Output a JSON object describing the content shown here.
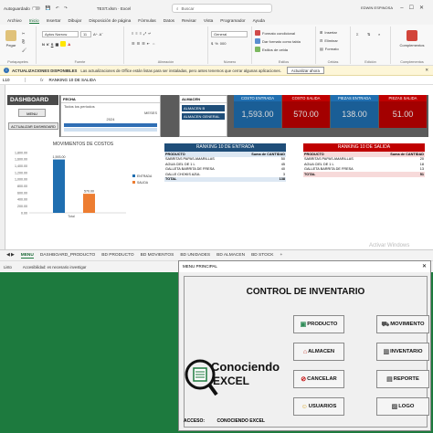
{
  "titlebar": {
    "autosave": "Autoguardado",
    "filename": "TEST.xlsm  ·  Excel",
    "search_placeholder": "Buscar",
    "user": "EDWIN ESPINOSA"
  },
  "menu": [
    "Archivo",
    "Inicio",
    "Insertar",
    "Dibujar",
    "Disposición de página",
    "Fórmulas",
    "Datos",
    "Revisar",
    "Vista",
    "Programador",
    "Ayuda"
  ],
  "menu_active": "Inicio",
  "ribbon": {
    "pegar": "Pegar",
    "portapapeles": "Portapapeles",
    "font_name": "Aptos Narrow",
    "font_size": "11",
    "fuente": "Fuente",
    "alineacion": "Alineación",
    "number_format": "General",
    "numero": "Número",
    "formato_condicional": "Formato condicional",
    "dar_formato_tabla": "Dar formato como tabla",
    "estilos_celda": "Estilos de celda",
    "estilos": "Estilos",
    "insertar": "Insertar",
    "eliminar": "Eliminar",
    "formato": "Formato",
    "celdas": "Celdas",
    "edicion": "Edición",
    "complementos": "Complementos"
  },
  "notice": {
    "title": "ACTUALIZACIONES DISPONIBLES",
    "text": "Las actualizaciones de Office están listas para ser instaladas, pero antes tenemos que cerrar algunas aplicaciones.",
    "button": "Actualizar ahora"
  },
  "formula_bar": {
    "ref": "L10",
    "fx": "fx",
    "value": "RANKING 10 DE SALIDA"
  },
  "dashboard": {
    "title": "DASHBOARD",
    "menu_button": "MENU",
    "update_button": "ACTUALIZAR DASHBOARD",
    "date_slicer": {
      "header": "FECHA",
      "period": "Todos los períodos",
      "unit": "MESES",
      "year": "2024"
    },
    "alm_slicer": {
      "header": "ALMACEN",
      "items": [
        "ALMACEN B",
        "ALMACEN GENERAL"
      ]
    },
    "kpis": [
      {
        "label": "COSTO ENTRADA",
        "value": "1,593.00",
        "color": "#1f6eb0"
      },
      {
        "label": "COSTO SALIDA",
        "value": "570.00",
        "color": "#c00000"
      },
      {
        "label": "PIEZAS ENTRADA",
        "value": "138.00",
        "color": "#1f6eb0"
      },
      {
        "label": "PIEZAS SALIDA",
        "value": "51.00",
        "color": "#c00000"
      }
    ]
  },
  "rank_in": {
    "title": "RANKING 10 DE ENTRADA",
    "header_color": "#1f4e79",
    "col1": "PRODUCTO",
    "col2": "Suma de CANTIDAD",
    "rows": [
      {
        "p": "SABRITAS PAPAS AMARILLAS",
        "q": "50"
      },
      {
        "p": "AGUA CIEL DE 1 L",
        "q": "45"
      },
      {
        "p": "GALLETA BARRITA DE FRESA",
        "q": "40"
      },
      {
        "p": "GALLE CHOKIS AZUL",
        "q": "3"
      }
    ],
    "total_label": "TOTAL",
    "total": "138"
  },
  "rank_out": {
    "title": "RANKING 10 DE SALIDA",
    "header_color": "#c00000",
    "col1": "PRODUCTO",
    "col2": "Suma de CANTIDAD",
    "rows": [
      {
        "p": "SABRITAS PAPAS AMARILLAS",
        "q": "20"
      },
      {
        "p": "AGUA CIEL DE 1 L",
        "q": "18"
      },
      {
        "p": "GALLETA BARRITA DE FRESA",
        "q": "13"
      }
    ],
    "total_label": "TOTAL",
    "total": "51"
  },
  "chart_data": {
    "type": "bar",
    "title": "MOVIMIENTOS DE COSTOS",
    "categories": [
      "Total"
    ],
    "series": [
      {
        "name": "ENTRADA",
        "values": [
          1593
        ],
        "color": "#1f6eb0"
      },
      {
        "name": "SALIDA",
        "values": [
          570
        ],
        "color": "#ed7d31"
      }
    ],
    "data_labels": [
      "1,593.00",
      "570.00"
    ],
    "ylim": [
      0,
      1800
    ],
    "yticks": [
      "1,800.00",
      "1,600.00",
      "1,400.00",
      "1,200.00",
      "1,000.00",
      "800.00",
      "600.00",
      "400.00",
      "200.00",
      "0.00"
    ]
  },
  "tabs": [
    "MENU",
    "DASHBOARD_PRODUCTO",
    "BD PRODUCTO",
    "BD MOVIENTOS",
    "BD UNIDADES",
    "BD ALMACEN",
    "BD STOCK"
  ],
  "tab_active": "MENU",
  "watermark": "Activar Windows",
  "status": {
    "ready": "Listo",
    "accessibility": "Accesibilidad: es necesario investigar"
  },
  "form": {
    "title": "MENU PRINCIPAL",
    "heading": "CONTROL DE INVENTARIO",
    "logo_line1": "Conociendo",
    "logo_line2": "EXCEL",
    "buttons": {
      "producto": "PRODUCTO",
      "movimiento": "MOVIMIENTO",
      "almacen": "ALMACEN",
      "inventario": "INVENTARIO",
      "cancelar": "CANCELAR",
      "reporte": "REPORTE",
      "usuarios": "USUARIOS",
      "logo": "LOGO"
    },
    "acceso_label": "ACCESO:",
    "acceso_value": "CONOCIENDO EXCEL"
  }
}
